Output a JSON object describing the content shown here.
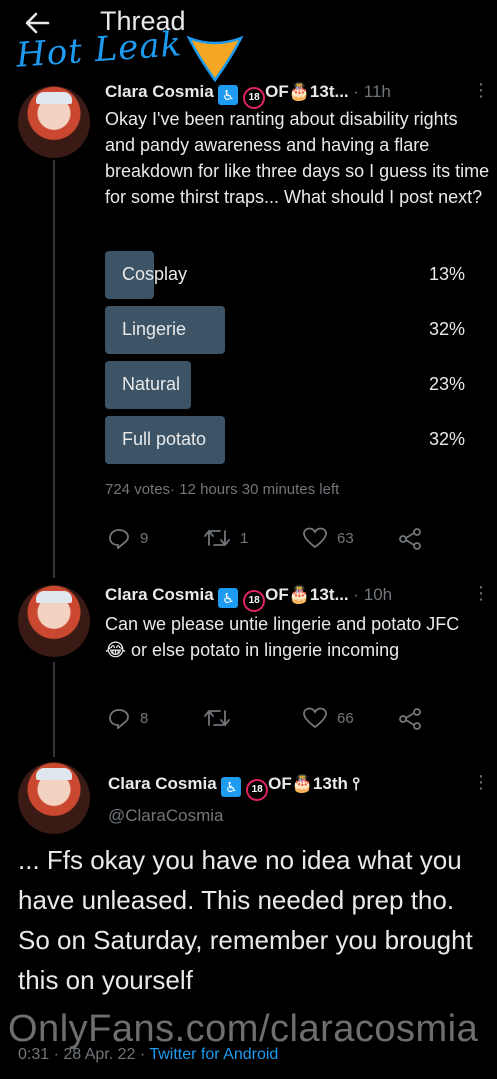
{
  "header": {
    "title": "Thread",
    "overlay_text": "Hot Leak"
  },
  "author": {
    "name_short": "Clara Cosmia",
    "badge_tail_short": "OF🎂13t...",
    "badge_tail_full": "OF🎂13th",
    "handle": "@ClaraCosmia"
  },
  "tweet1": {
    "time": "· 11h",
    "text": "Okay I've been ranting about disability rights and pandy awareness and having a flare breakdown for like three days so I guess its time for some thirst traps... What should I post next?",
    "poll": {
      "options": [
        {
          "label": "Cosplay",
          "pct": "13%",
          "value": 13
        },
        {
          "label": "Lingerie",
          "pct": "32%",
          "value": 32
        },
        {
          "label": "Natural",
          "pct": "23%",
          "value": 23
        },
        {
          "label": "Full potato",
          "pct": "32%",
          "value": 32
        }
      ],
      "votes": "724 votes",
      "time_left": "12 hours 30 minutes left"
    },
    "replies": "9",
    "retweets": "1",
    "likes": "63"
  },
  "tweet2": {
    "time": "· 10h",
    "text": "Can we please untie lingerie and potato JFC 😂 or else potato in lingerie incoming",
    "replies": "8",
    "retweets": "",
    "likes": "66"
  },
  "tweet3": {
    "text": "... Ffs okay you have no idea what you have unleased. This needed prep tho. So on Saturday, remember you brought this on yourself",
    "time": "0:31 · 28 Apr. 22 ·",
    "source": "Twitter for Android"
  },
  "watermark": "OnlyFans.com/claracosmia",
  "colors": {
    "accent": "#1d9bf0",
    "poll_fill": "#3d5466",
    "muted": "#71767b"
  }
}
